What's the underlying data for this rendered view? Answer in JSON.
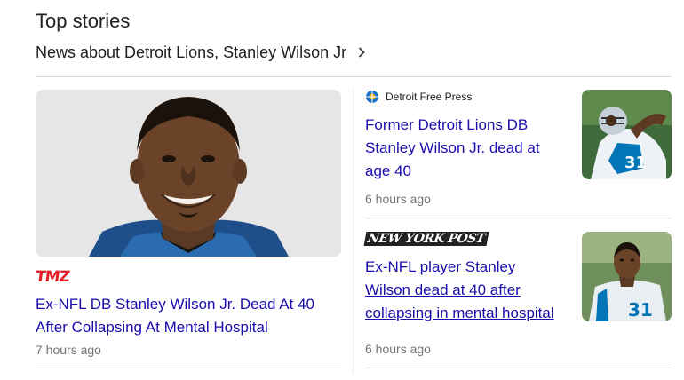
{
  "section": {
    "title": "Top stories",
    "topic_link": "News about Detroit Lions, Stanley Wilson Jr"
  },
  "stories": [
    {
      "source": "TMZ",
      "headline": "Ex-NFL DB Stanley Wilson Jr. Dead At 40 After Collapsing At Mental Hospital",
      "time": "7 hours ago",
      "image": "player-portrait"
    },
    {
      "source": "Detroit Free Press",
      "source_icon": "detroit-free-press-logo-icon",
      "headline": "Former Detroit Lions DB Stanley Wilson Jr. dead at age 40",
      "time": "6 hours ago",
      "image": "player-action-photo"
    },
    {
      "source": "NEW YORK POST",
      "headline": "Ex-NFL player Stanley Wilson dead at 40 after collapsing in mental hospital",
      "time": "6 hours ago",
      "image": "player-sideline-photo"
    }
  ],
  "colors": {
    "link": "#1a0dab",
    "meta": "#70757a",
    "tmz_red": "#e41e26",
    "lions_blue": "#0076b6"
  }
}
